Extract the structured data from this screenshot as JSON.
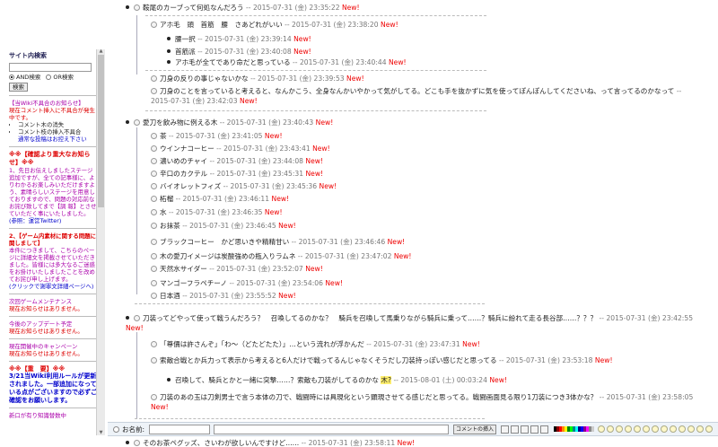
{
  "sidebar": {
    "search_title": "サイト内検索",
    "and_label": "AND検索",
    "or_label": "OR検索",
    "search_button": "検索",
    "notice_title": "【当Wiki不具合のお知らせ】",
    "notice_text": "現在コメント挿入に不具合が発生中です。",
    "notice_items": [
      "コメント木の消失",
      "コメント枝の挿入不具合"
    ],
    "notice_link": "通常な投稿はお控え下さい",
    "important_title": "※※【確認より重大なお知らせ】※※",
    "important_1": "1、先日お伝えしましたステージ追加ですが、全ての記事様に、よりわかるお楽しみいただけますよう、素晴らしいステージを用意しておりますので、問題の対応前なお詫び致してまで【調 報】とさせていただく事にいたしました。",
    "important_1_src": "(参照：運営Twitter)",
    "important_2_title": "2、【ゲーム内素材に関する問題に関しまして】",
    "important_2": "本件につきまして、こちらのページに詳細文を掲載させていただきました。皆様には多大なるご迷惑をお掛けいたしましたことを改めてお詫び申し上げます。",
    "important_2_link": "(クリックで謝罪文詳細ページへ)",
    "maint_title": "次回ゲームメンテナンス",
    "maint_text": "現在お知らせはありません。",
    "update_title": "今後のアップデート予定",
    "update_text": "現在お知らせはありません。",
    "campaign_title": "現在開催中のキャンペーン",
    "campaign_text": "現在お知らせはありません。",
    "rule_title": "※※【重　要】※※",
    "rule_text": "3/21当Wiki利用ルールが更新されました。一部追加になっている点がございますので必ずご確認をお願いします。",
    "footer_text": "新口が有り知識替数中"
  },
  "comments": [
    {
      "level": 0,
      "marker": "bullet-radio",
      "text": "鞍尾のカーブって何処なんだろう",
      "date": "2015-07-31 (金) 23:35:22",
      "new": "New!"
    },
    {
      "level": 1,
      "marker": "radio",
      "text": "アホ毛　頭　首筋　腰　さあどれがいい",
      "date": "2015-07-31 (金) 23:38:20",
      "new": "New!"
    },
    {
      "level": 2,
      "marker": "bullet",
      "text": "腰一択",
      "date": "2015-07-31 (金) 23:39:14",
      "new": "New!"
    },
    {
      "level": 2,
      "marker": "bullet",
      "text": "首筋派",
      "date": "2015-07-31 (金) 23:40:08",
      "new": "New!"
    },
    {
      "level": 2,
      "marker": "bullet",
      "text": "アホ毛が全てであり命だと思っている",
      "date": "2015-07-31 (金) 23:40:44",
      "new": "New!"
    },
    {
      "level": 1,
      "marker": "radio",
      "text": "刀身の反りの事じゃないかな",
      "date": "2015-07-31 (金) 23:39:53",
      "new": "New!"
    },
    {
      "level": 1,
      "marker": "radio",
      "text": "刀身のことを言っていると考えると、なんかこう、全身なんかいやかって気がしてる。どこも手を抜かずに気を使ってぽんぽんしてくださいね、って言ってるのかなって",
      "date": "2015-07-31 (金) 23:42:03",
      "new": "New!",
      "wrap": true
    },
    {
      "level": 0,
      "marker": "bullet-radio",
      "text": "愛刀を飲み物に例える木",
      "date": "2015-07-31 (金) 23:40:43",
      "new": "New!"
    },
    {
      "level": 1,
      "marker": "radio",
      "text": "茶",
      "date": "2015-07-31 (金) 23:41:05",
      "new": "New!"
    },
    {
      "level": 1,
      "marker": "radio",
      "text": "ウインナコーヒー",
      "date": "2015-07-31 (金) 23:43:41",
      "new": "New!"
    },
    {
      "level": 1,
      "marker": "radio",
      "text": "濃いめのチャイ",
      "date": "2015-07-31 (金) 23:44:08",
      "new": "New!"
    },
    {
      "level": 1,
      "marker": "radio",
      "text": "辛口のカクテル",
      "date": "2015-07-31 (金) 23:45:31",
      "new": "New!"
    },
    {
      "level": 1,
      "marker": "radio",
      "text": "バイオレットフィズ",
      "date": "2015-07-31 (金) 23:45:36",
      "new": "New!"
    },
    {
      "level": 1,
      "marker": "radio",
      "text": "柘榴",
      "date": "2015-07-31 (金) 23:46:11",
      "new": "New!"
    },
    {
      "level": 1,
      "marker": "radio",
      "text": "水",
      "date": "2015-07-31 (金) 23:46:35",
      "new": "New!"
    },
    {
      "level": 1,
      "marker": "radio",
      "text": "お抹茶",
      "date": "2015-07-31 (金) 23:46:45",
      "new": "New!"
    },
    {
      "level": 1,
      "marker": "radio",
      "text": "ブラックコーヒー　かど思いきや精精甘い",
      "date": "2015-07-31 (金) 23:46:46",
      "new": "New!"
    },
    {
      "level": 1,
      "marker": "radio",
      "text": "木の愛刀イメージは炭酸強めの瓶入りラムネ",
      "date": "2015-07-31 (金) 23:47:02",
      "new": "New!"
    },
    {
      "level": 1,
      "marker": "radio",
      "text": "天然水サイダー",
      "date": "2015-07-31 (金) 23:52:07",
      "new": "New!"
    },
    {
      "level": 1,
      "marker": "radio",
      "text": "マンゴーフラペチーノ",
      "date": "2015-07-31 (金) 23:54:06",
      "new": "New!"
    },
    {
      "level": 1,
      "marker": "radio",
      "text": "日本酒",
      "date": "2015-07-31 (金) 23:55:52",
      "new": "New!"
    },
    {
      "level": 0,
      "marker": "bullet-radio",
      "text": "刀装ってどやって使って戦うんだろう？　召喚してるのかな？　騎兵を召喚して馬乗りながら騎兵に乗って……？騎兵に紛れて走る長谷部……？？？",
      "date": "2015-07-31 (金) 23:42:55",
      "new": "New!",
      "wrap": true
    },
    {
      "level": 1,
      "marker": "radio",
      "text": "「尊價は許さんぞ」「わ～（どたどたた）」…という流れが浮かんだ",
      "date": "2015-07-31 (金) 23:47:31",
      "new": "New!"
    },
    {
      "level": 1,
      "marker": "radio",
      "text": "索敵合戦とか兵力って表示から考えると6人だけで戦ってるんじゃなくそうだし刀装持っぽい感じだと思ってる",
      "date": "2015-07-31 (金) 23:53:18",
      "new": "New!",
      "wrap": true
    },
    {
      "level": 2,
      "marker": "bullet",
      "text": "召喚して、騎兵とかと一緒に突撃……？索敵も刀装がしてるのかな",
      "hl": "木?",
      "date": "2015-08-01 (土) 00:03:24",
      "new": "New!"
    },
    {
      "level": 1,
      "marker": "radio",
      "text": "刀装のあの玉は刀剣男士で言う本体の刀で、戦闘時には具現化という顕現させてる感じだと思ってる。戦闘画面見る限り1刀装につき3体かな？",
      "date": "2015-07-31 (金) 23:58:05",
      "new": "New!",
      "wrap": true
    },
    {
      "level": 0,
      "marker": "bullet-radio",
      "text": "そのお茶ペグッズ、さいわが欲しいんですけど……",
      "date": "2015-07-31 (金) 23:58:11",
      "new": "New!"
    }
  ],
  "comment_bar": {
    "name_label": "お名前:",
    "submit_label": "コメントの挿入"
  },
  "colors": {
    "new": "#e00000",
    "date": "#777777",
    "accent": "#00c"
  }
}
